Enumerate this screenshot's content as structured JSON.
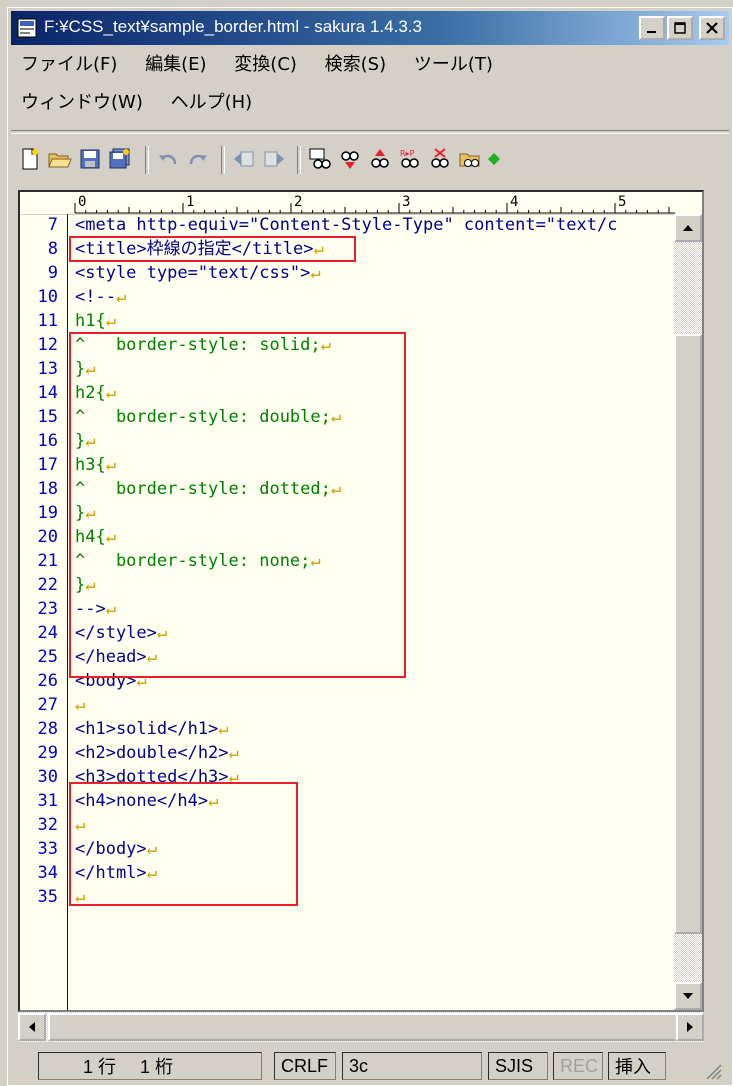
{
  "window": {
    "title": "F:¥CSS_text¥sample_border.html - sakura 1.4.3.3"
  },
  "menu": {
    "row1": [
      "ファイル(F)",
      "編集(E)",
      "変換(C)",
      "検索(S)",
      "ツール(T)"
    ],
    "row2": [
      "ウィンドウ(W)",
      "ヘルプ(H)"
    ]
  },
  "toolbar": {
    "icons": [
      "new-file-icon",
      "open-folder-icon",
      "save-icon",
      "save-all-icon",
      "undo-icon",
      "redo-icon",
      "jump-back-icon",
      "jump-forward-icon",
      "search-icon",
      "search-prev-icon",
      "search-next-icon",
      "replace-icon",
      "delete-search-icon",
      "open-file-icon",
      "bookmark-icon"
    ]
  },
  "ruler": {
    "labels": [
      "0",
      "1",
      "2",
      "3",
      "4",
      "5"
    ]
  },
  "code": [
    {
      "n": "7",
      "text": "<meta http-equiv=\"Content-Style-Type\" content=\"text/c",
      "ret": false
    },
    {
      "n": "8",
      "text": "<title>枠線の指定</title>",
      "ret": true
    },
    {
      "n": "9",
      "text": "<style type=\"text/css\">",
      "ret": true
    },
    {
      "n": "10",
      "text": "<!--",
      "ret": true
    },
    {
      "n": "11",
      "text": "h1{",
      "ret": true
    },
    {
      "n": "12",
      "text": "^   border-style: solid;",
      "ret": true
    },
    {
      "n": "13",
      "text": "}",
      "ret": true
    },
    {
      "n": "14",
      "text": "h2{",
      "ret": true
    },
    {
      "n": "15",
      "text": "^   border-style: double;",
      "ret": true
    },
    {
      "n": "16",
      "text": "}",
      "ret": true
    },
    {
      "n": "17",
      "text": "h3{",
      "ret": true
    },
    {
      "n": "18",
      "text": "^   border-style: dotted;",
      "ret": true
    },
    {
      "n": "19",
      "text": "}",
      "ret": true
    },
    {
      "n": "20",
      "text": "h4{",
      "ret": true
    },
    {
      "n": "21",
      "text": "^   border-style: none;",
      "ret": true
    },
    {
      "n": "22",
      "text": "}",
      "ret": true
    },
    {
      "n": "23",
      "text": "-->",
      "ret": true
    },
    {
      "n": "24",
      "text": "</style>",
      "ret": true
    },
    {
      "n": "25",
      "text": "</head>",
      "ret": true
    },
    {
      "n": "26",
      "text": "<body>",
      "ret": true
    },
    {
      "n": "27",
      "text": "",
      "ret": true
    },
    {
      "n": "28",
      "text": "<h1>solid</h1>",
      "ret": true
    },
    {
      "n": "29",
      "text": "<h2>double</h2>",
      "ret": true
    },
    {
      "n": "30",
      "text": "<h3>dotted</h3>",
      "ret": true
    },
    {
      "n": "31",
      "text": "<h4>none</h4>",
      "ret": true
    },
    {
      "n": "32",
      "text": "",
      "ret": true
    },
    {
      "n": "33",
      "text": "</body>",
      "ret": true
    },
    {
      "n": "34",
      "text": "</html>",
      "ret": true
    },
    {
      "n": "35",
      "text": "",
      "ret": true
    }
  ],
  "status": {
    "line": "1 行",
    "col": "1 桁",
    "eol": "CRLF",
    "char": "3c",
    "encoding": "SJIS",
    "rec": "REC",
    "mode": "挿入"
  },
  "colors": {
    "highlight": "#e8202c",
    "title_gradient_start": "#0a246a",
    "editor_bg": "#fffff0"
  }
}
